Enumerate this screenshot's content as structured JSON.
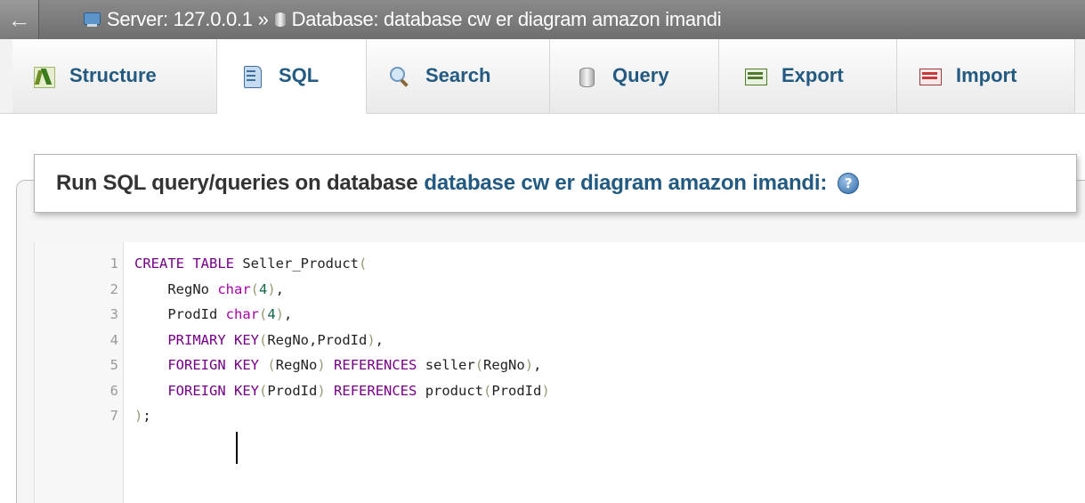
{
  "breadcrumb": {
    "back_glyph": "←",
    "server_label": "Server: 127.0.0.1",
    "separator": "»",
    "database_label": "Database: database cw er diagram amazon imandi",
    "server_icon": "server-icon",
    "database_icon": "database-icon"
  },
  "tabs": [
    {
      "label": "Structure",
      "icon": "structure-icon",
      "active": false
    },
    {
      "label": "SQL",
      "icon": "sql-icon",
      "active": true
    },
    {
      "label": "Search",
      "icon": "search-icon",
      "active": false
    },
    {
      "label": "Query",
      "icon": "query-icon",
      "active": false
    },
    {
      "label": "Export",
      "icon": "export-icon",
      "active": false
    },
    {
      "label": "Import",
      "icon": "import-icon",
      "active": false
    }
  ],
  "panel": {
    "heading_prefix": "Run SQL query/queries on database",
    "database_name": "database cw er diagram amazon imandi:",
    "help_glyph": "?"
  },
  "editor": {
    "lines": [
      {
        "n": "1",
        "text": "CREATE TABLE Seller_Product("
      },
      {
        "n": "2",
        "text": "    RegNo char(4),"
      },
      {
        "n": "3",
        "text": "    ProdId char(4),"
      },
      {
        "n": "4",
        "text": "    PRIMARY KEY(RegNo,ProdId),"
      },
      {
        "n": "5",
        "text": "    FOREIGN KEY (RegNo) REFERENCES seller(RegNo),"
      },
      {
        "n": "6",
        "text": "    FOREIGN KEY(ProdId) REFERENCES product(ProdId)"
      },
      {
        "n": "7",
        "text": ");"
      }
    ]
  },
  "colors": {
    "accent_blue": "#235a81",
    "keyword": "#770088",
    "number": "#116644",
    "topbar": "#7a7a7a"
  }
}
